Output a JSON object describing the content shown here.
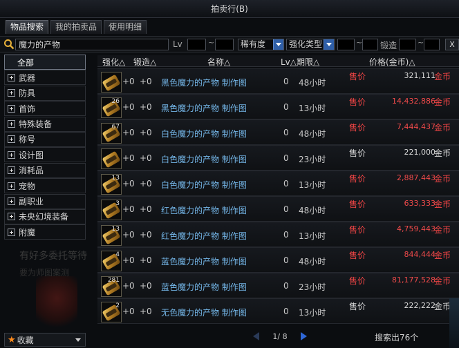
{
  "window": {
    "title": "拍卖行(B)"
  },
  "tabs": [
    "物品搜索",
    "我的拍卖品",
    "使用明细"
  ],
  "search": {
    "value": "魔力的产物",
    "lv_label": "Lv",
    "tilde": "~",
    "rarity_label": "稀有度",
    "enhance_type_label": "强化类型",
    "forge_label": "锻造",
    "clear_label": "X"
  },
  "categories": {
    "all": "全部",
    "items": [
      "武器",
      "防具",
      "首饰",
      "特殊装备",
      "称号",
      "设计图",
      "消耗品",
      "宠物",
      "副职业",
      "未央幻境装备",
      "附魔"
    ]
  },
  "table": {
    "headers": {
      "enhance": "强化△",
      "forge": "锻造△",
      "name": "名称△",
      "lv_time": "Lv△期限△",
      "price": "价格(金币)△"
    },
    "rows": [
      {
        "count": "",
        "enhance": "+0",
        "forge": "+0",
        "name": "黑色魔力的产物 制作图",
        "lv": "0",
        "time": "48小时",
        "label": "售价",
        "price": "321,111",
        "unit": "金币",
        "label_style": "red",
        "price_style": "white"
      },
      {
        "count": "26",
        "enhance": "+0",
        "forge": "+0",
        "name": "黑色魔力的产物 制作图",
        "lv": "0",
        "time": "13小时",
        "label": "售价",
        "price": "14,432,886",
        "unit": "金币",
        "label_style": "red",
        "price_style": "red"
      },
      {
        "count": "67",
        "enhance": "+0",
        "forge": "+0",
        "name": "白色魔力的产物 制作图",
        "lv": "0",
        "time": "48小时",
        "label": "售价",
        "price": "7,444,437",
        "unit": "金币",
        "label_style": "red",
        "price_style": "red"
      },
      {
        "count": "",
        "enhance": "+0",
        "forge": "+0",
        "name": "白色魔力的产物 制作图",
        "lv": "0",
        "time": "23小时",
        "label": "售价",
        "price": "221,000",
        "unit": "金币",
        "label_style": "white",
        "price_style": "white"
      },
      {
        "count": "13",
        "enhance": "+0",
        "forge": "+0",
        "name": "白色魔力的产物 制作图",
        "lv": "0",
        "time": "13小时",
        "label": "售价",
        "price": "2,887,443",
        "unit": "金币",
        "label_style": "red",
        "price_style": "red"
      },
      {
        "count": "3",
        "enhance": "+0",
        "forge": "+0",
        "name": "红色魔力的产物 制作图",
        "lv": "0",
        "time": "48小时",
        "label": "售价",
        "price": "633,333",
        "unit": "金币",
        "label_style": "red",
        "price_style": "red"
      },
      {
        "count": "13",
        "enhance": "+0",
        "forge": "+0",
        "name": "红色魔力的产物 制作图",
        "lv": "0",
        "time": "13小时",
        "label": "售价",
        "price": "4,759,443",
        "unit": "金币",
        "label_style": "red",
        "price_style": "red"
      },
      {
        "count": "4",
        "enhance": "+0",
        "forge": "+0",
        "name": "蓝色魔力的产物 制作图",
        "lv": "0",
        "time": "48小时",
        "label": "售价",
        "price": "844,444",
        "unit": "金币",
        "label_style": "red",
        "price_style": "red"
      },
      {
        "count": "281",
        "enhance": "+0",
        "forge": "+0",
        "name": "蓝色魔力的产物 制作图",
        "lv": "0",
        "time": "23小时",
        "label": "售价",
        "price": "81,177,528",
        "unit": "金币",
        "label_style": "red",
        "price_style": "red"
      },
      {
        "count": "2",
        "enhance": "+0",
        "forge": "+0",
        "name": "无色魔力的产物 制作图",
        "lv": "0",
        "time": "13小时",
        "label": "售价",
        "price": "222,222",
        "unit": "金币",
        "label_style": "white",
        "price_style": "white"
      }
    ]
  },
  "background_text": {
    "line1": "有好多委托等待",
    "line2": "要为师图案测"
  },
  "favorites": {
    "label": "收藏"
  },
  "pager": {
    "text": "1/ 8"
  },
  "result_count": "搜索出76个",
  "colors": {
    "accent_red": "#f34545",
    "name_blue": "#74b6e8",
    "pager_blue": "#2f67d6",
    "star_orange": "#ff8a1c"
  },
  "icons": {
    "item": "scroll-icon",
    "search": "search-icon",
    "favorites": "star-icon",
    "prev": "prev-arrow-icon",
    "next": "next-arrow-icon"
  }
}
